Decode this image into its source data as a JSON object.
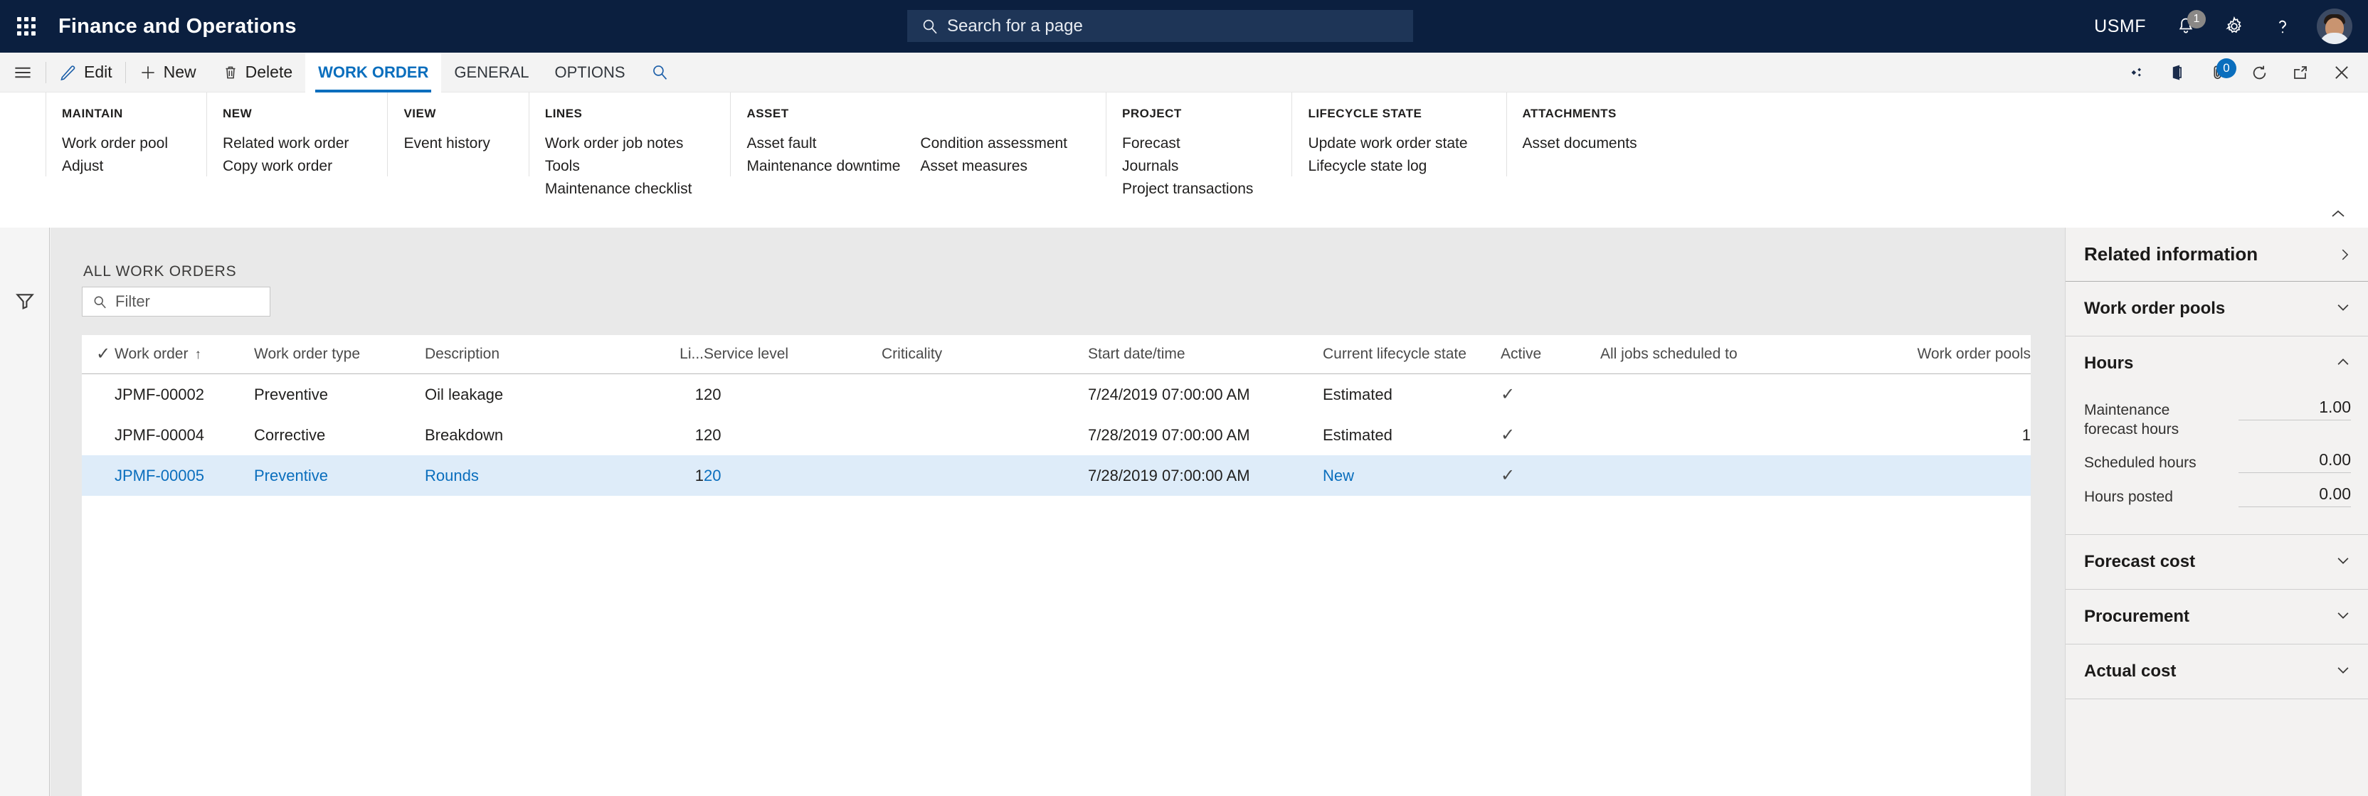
{
  "topbar": {
    "waffle_label": "app-launcher",
    "app_title": "Finance and Operations",
    "search_placeholder": "Search for a page",
    "search_value": "",
    "company": "USMF",
    "notification_count": "1",
    "icons": [
      "bell-icon",
      "gear-icon",
      "help-icon",
      "avatar"
    ]
  },
  "commandbar": {
    "menu_label": "hamburger-icon",
    "edit_label": "Edit",
    "new_label": "New",
    "delete_label": "Delete",
    "tabs": [
      {
        "label": "WORK ORDER",
        "active": true
      },
      {
        "label": "GENERAL",
        "active": false
      },
      {
        "label": "OPTIONS",
        "active": false
      }
    ],
    "right_icons": [
      {
        "name": "relationships-icon",
        "badge": ""
      },
      {
        "name": "office-app-icon",
        "badge": ""
      },
      {
        "name": "attachments-icon",
        "badge": "0"
      },
      {
        "name": "refresh-icon",
        "badge": ""
      },
      {
        "name": "open-in-new-window-icon",
        "badge": ""
      },
      {
        "name": "close-icon",
        "badge": ""
      }
    ]
  },
  "ribbon": {
    "groups": [
      {
        "title": "MAINTAIN",
        "columns": [
          [
            "Work order pool",
            "Adjust"
          ]
        ]
      },
      {
        "title": "NEW",
        "columns": [
          [
            "Related work order",
            "Copy work order"
          ]
        ]
      },
      {
        "title": "VIEW",
        "columns": [
          [
            "Event history"
          ]
        ]
      },
      {
        "title": "LINES",
        "columns": [
          [
            "Work order job notes",
            "Tools",
            "Maintenance checklist"
          ]
        ]
      },
      {
        "title": "ASSET",
        "columns": [
          [
            "Asset fault",
            "Maintenance downtime"
          ],
          [
            "Condition assessment",
            "Asset measures"
          ]
        ]
      },
      {
        "title": "PROJECT",
        "columns": [
          [
            "Forecast",
            "Journals",
            "Project transactions"
          ]
        ]
      },
      {
        "title": "LIFECYCLE STATE",
        "columns": [
          [
            "Update work order state",
            "Lifecycle state log"
          ]
        ]
      },
      {
        "title": "ATTACHMENTS",
        "columns": [
          [
            "Asset documents"
          ]
        ]
      }
    ]
  },
  "grid": {
    "caption": "ALL WORK ORDERS",
    "filter_placeholder": "Filter",
    "filter_value": "",
    "sort_column": "Work order",
    "sort_direction": "ascending",
    "columns": [
      {
        "label": "",
        "key": "check",
        "align": "center"
      },
      {
        "label": "Work order",
        "key": "work_order",
        "align": "left",
        "sorted": true
      },
      {
        "label": "Work order type",
        "key": "work_order_type",
        "align": "left"
      },
      {
        "label": "Description",
        "key": "description",
        "align": "left"
      },
      {
        "label": "Li...",
        "key": "lines",
        "align": "right"
      },
      {
        "label": "Service level",
        "key": "service_level",
        "align": "left"
      },
      {
        "label": "Criticality",
        "key": "criticality",
        "align": "left"
      },
      {
        "label": "Start date/time",
        "key": "start_date_time",
        "align": "left"
      },
      {
        "label": "Current lifecycle state",
        "key": "lifecycle_state",
        "align": "left"
      },
      {
        "label": "Active",
        "key": "active",
        "align": "left"
      },
      {
        "label": "All jobs scheduled to",
        "key": "all_jobs_scheduled_to",
        "align": "left"
      },
      {
        "label": "Work order pools",
        "key": "work_order_pools",
        "align": "right"
      }
    ],
    "rows": [
      {
        "work_order": "JPMF-00002",
        "work_order_type": "Preventive",
        "description": "Oil leakage",
        "lines": "1",
        "service_level": "20",
        "criticality": "",
        "start_date_time": "7/24/2019 07:00:00 AM",
        "lifecycle_state": "Estimated",
        "active": "✓",
        "all_jobs_scheduled_to": "",
        "work_order_pools": "",
        "selected": false
      },
      {
        "work_order": "JPMF-00004",
        "work_order_type": "Corrective",
        "description": "Breakdown",
        "lines": "1",
        "service_level": "20",
        "criticality": "",
        "start_date_time": "7/28/2019 07:00:00 AM",
        "lifecycle_state": "Estimated",
        "active": "✓",
        "all_jobs_scheduled_to": "",
        "work_order_pools": "1",
        "selected": false
      },
      {
        "work_order": "JPMF-00005",
        "work_order_type": "Preventive",
        "description": "Rounds",
        "lines": "1",
        "service_level": "20",
        "criticality": "",
        "start_date_time": "7/28/2019 07:00:00 AM",
        "lifecycle_state": "New",
        "active": "✓",
        "all_jobs_scheduled_to": "",
        "work_order_pools": "",
        "selected": true
      }
    ]
  },
  "rightpanel": {
    "title": "Related information",
    "sections": [
      {
        "name": "work-order-pools",
        "title": "Work order pools",
        "expanded": false,
        "fields": []
      },
      {
        "name": "hours",
        "title": "Hours",
        "expanded": true,
        "fields": [
          {
            "label": "Maintenance forecast hours",
            "value": "1.00"
          },
          {
            "label": "Scheduled hours",
            "value": "0.00"
          },
          {
            "label": "Hours posted",
            "value": "0.00"
          }
        ]
      },
      {
        "name": "forecast-cost",
        "title": "Forecast cost",
        "expanded": false,
        "fields": []
      },
      {
        "name": "procurement",
        "title": "Procurement",
        "expanded": false,
        "fields": []
      },
      {
        "name": "actual-cost",
        "title": "Actual cost",
        "expanded": false,
        "fields": []
      }
    ]
  },
  "colors": {
    "navbar": "#0b1f3f",
    "accent": "#0a6ebd",
    "selected_row": "#deecf9",
    "panel_bg": "#f3f2f1",
    "workspace_bg": "#e9e9e9"
  }
}
